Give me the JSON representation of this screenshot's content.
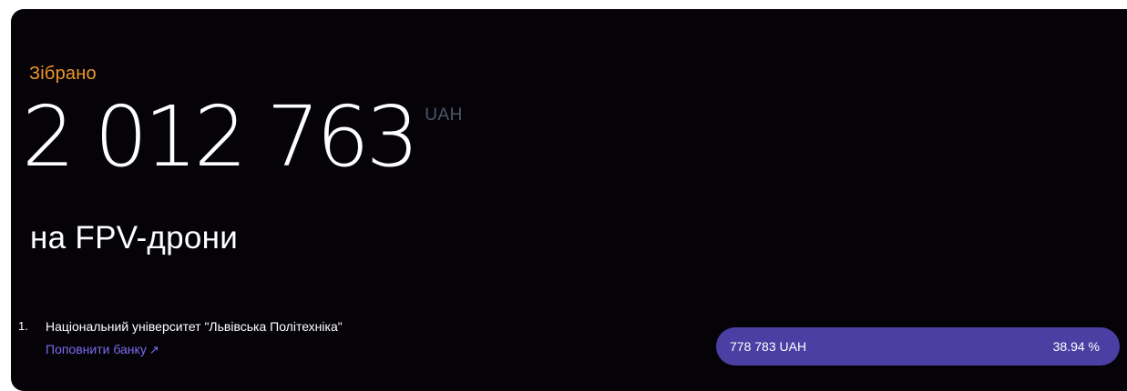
{
  "summary": {
    "collected_label": "Зібрано",
    "amount": "2 012 763",
    "currency": "UAH",
    "purpose": "на FPV-дрони"
  },
  "leaderboard": [
    {
      "rank": "1.",
      "name": "Національний університет \"Львівська Політехніка\"",
      "link_label": "Поповнити банку",
      "amount": "778 783 UAH",
      "percent": "38.94 %",
      "share": 0.3894
    }
  ],
  "colors": {
    "background": "#050308",
    "accent_orange": "#f0972a",
    "link_purple": "#7a6cf0",
    "bar_purple": "#4b3fa3",
    "currency_gray": "#4e5768"
  },
  "icons": {
    "link_arrow": "arrow-up-right-icon"
  }
}
